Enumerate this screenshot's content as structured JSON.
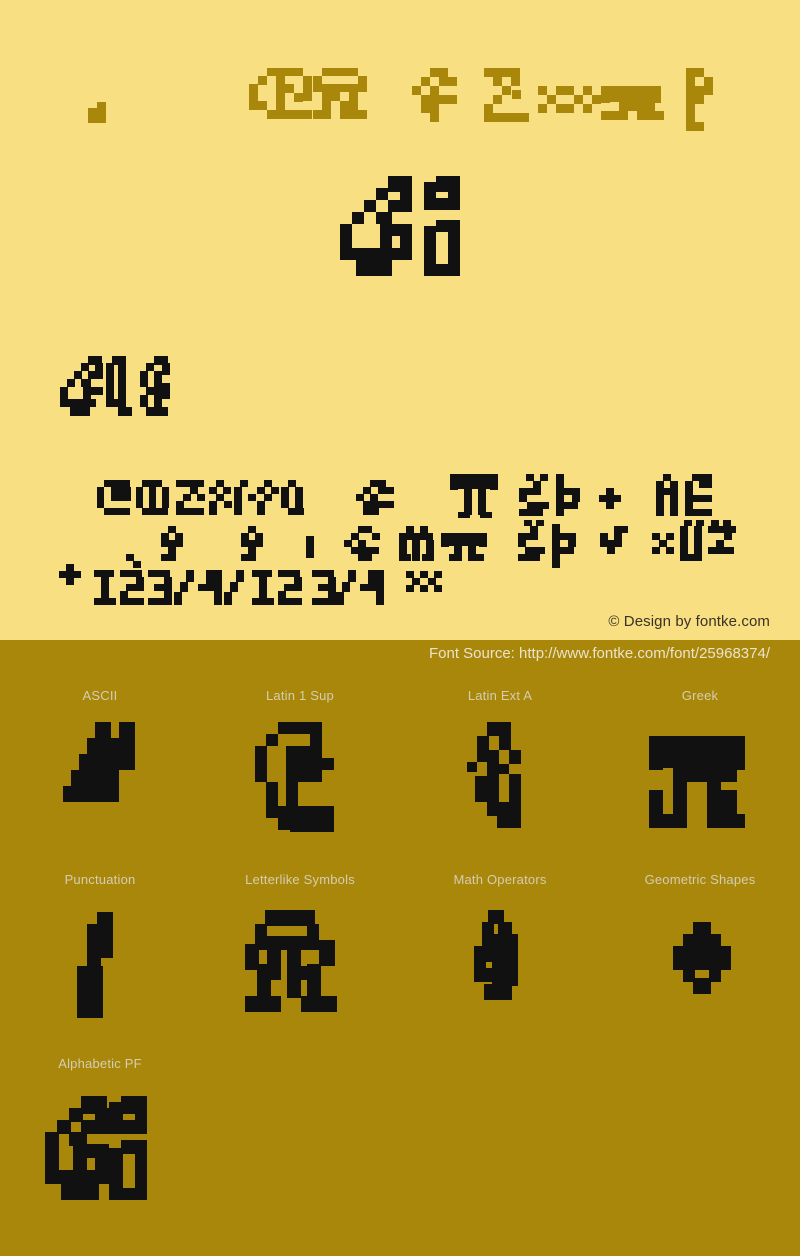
{
  "page": {
    "kind": "font-specimen",
    "preview_bg": "#f7df82",
    "sampler_bg": "#a8870b",
    "glyph_dark": "#111111",
    "glyph_gold": "#a8870b",
    "label_color": "#d5cdb2"
  },
  "preview": {
    "copyright": "© Design by fontke.com",
    "title_row_note": "Version 1.00 November 3, 2017, initial release",
    "hero_note": "Ab",
    "sub_note": "Sample",
    "paragraph_note": "Character set sample"
  },
  "sampler": {
    "font_source": "Font Source: http://www.fontke.com/font/25968374/",
    "blocks": [
      {
        "label": "ASCII"
      },
      {
        "label": "Latin 1 Sup"
      },
      {
        "label": "Latin Ext A"
      },
      {
        "label": "Greek"
      },
      {
        "label": "Punctuation"
      },
      {
        "label": "Letterlike Symbols"
      },
      {
        "label": "Math Operators"
      },
      {
        "label": "Geometric Shapes"
      },
      {
        "label": "Alphabetic PF"
      }
    ]
  },
  "glyph_art": {
    "note": "pixel-block glyph matrices; 1 = filled cell",
    "ascii": [
      "0110000110",
      "1111001111",
      "0110110110",
      "0011111111",
      "0110110110",
      "1111001111",
      "1100001100"
    ],
    "latin1sup": [
      "00011111000",
      "00110001000",
      "01100001000",
      "11000111110",
      "11001100011",
      "11000100000",
      "11100100000",
      "00110100000",
      "00011111100",
      "00000111110"
    ],
    "latinexta": [
      "000111000",
      "001100100",
      "011000110",
      "110000110",
      "010001100",
      "001111000",
      "011000000",
      "110000000",
      "111111100",
      "011111100"
    ],
    "greek": [
      "11111111111",
      "11111111111",
      "11000110011",
      "11000110011",
      "00001100110",
      "00001100110",
      "00001100110",
      "00011001100",
      "00011001100",
      "00011001100"
    ],
    "punctuation": [
      "00110",
      "01110",
      "01110",
      "01110",
      "11100",
      "11000",
      "11000",
      "11000",
      "11000",
      "11000"
    ],
    "letterlike": [
      "001111110000",
      "011000011000",
      "011111111100",
      "111000001110",
      "110000000110",
      "000011100000",
      "000011100000",
      "011011011110",
      "011011011000",
      "111011011111"
    ],
    "mathops": [
      "001100",
      "011110",
      "011011",
      "110011",
      "110011",
      "100110",
      "001100",
      "011000",
      "111000",
      "110000"
    ],
    "geometric": [
      "0011100",
      "0110110",
      "1101011",
      "1010101",
      "1101011",
      "0110110",
      "0011100"
    ],
    "alphabeticpf": [
      "0000111001110",
      "0001101001011",
      "0011011001110",
      "0110100000000",
      "1101000001100",
      "1000110001010",
      "1000011001010",
      "1100001001010",
      "0111001001010",
      "0011110001110"
    ],
    "title_words": [
      "00111000",
      "01000100",
      "01011100",
      "01010100",
      "01011100",
      "01000100",
      "00111000"
    ]
  }
}
